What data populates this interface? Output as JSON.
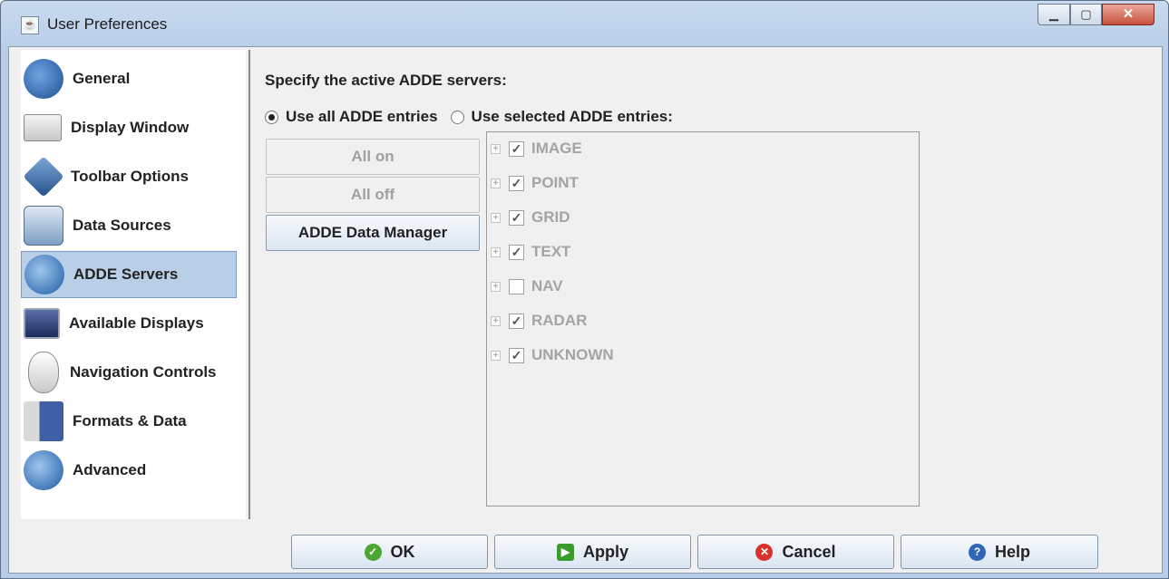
{
  "window": {
    "title": "User Preferences"
  },
  "sidebar": {
    "items": [
      {
        "label": "General",
        "icon": "general-icon",
        "color": "#2f6fb3"
      },
      {
        "label": "Display Window",
        "icon": "display-window-icon",
        "color": "#d9d9d9"
      },
      {
        "label": "Toolbar Options",
        "icon": "toolbar-options-icon",
        "color": "#3c6fa8"
      },
      {
        "label": "Data Sources",
        "icon": "data-sources-icon",
        "color": "#7d9fc4"
      },
      {
        "label": "ADDE Servers",
        "icon": "adde-servers-icon",
        "color": "#2c71c0",
        "selected": true
      },
      {
        "label": "Available Displays",
        "icon": "available-displays-icon",
        "color": "#3b4e85"
      },
      {
        "label": "Navigation Controls",
        "icon": "navigation-controls-icon",
        "color": "#cfcfcf"
      },
      {
        "label": "Formats & Data",
        "icon": "formats-data-icon",
        "color": "#3f5fa6"
      },
      {
        "label": "Advanced",
        "icon": "advanced-icon",
        "color": "#2c71c0"
      }
    ]
  },
  "main": {
    "heading": "Specify the active ADDE servers:",
    "radio_all": "Use all ADDE entries",
    "radio_selected": "Use selected ADDE entries:",
    "all_on": "All on",
    "all_off": "All off",
    "data_manager": "ADDE Data Manager",
    "tree": [
      {
        "label": "IMAGE",
        "checked": true
      },
      {
        "label": "POINT",
        "checked": true
      },
      {
        "label": "GRID",
        "checked": true
      },
      {
        "label": "TEXT",
        "checked": true
      },
      {
        "label": "NAV",
        "checked": false
      },
      {
        "label": "RADAR",
        "checked": true
      },
      {
        "label": "UNKNOWN",
        "checked": true
      }
    ]
  },
  "footer": {
    "ok": "OK",
    "apply": "Apply",
    "cancel": "Cancel",
    "help": "Help"
  }
}
